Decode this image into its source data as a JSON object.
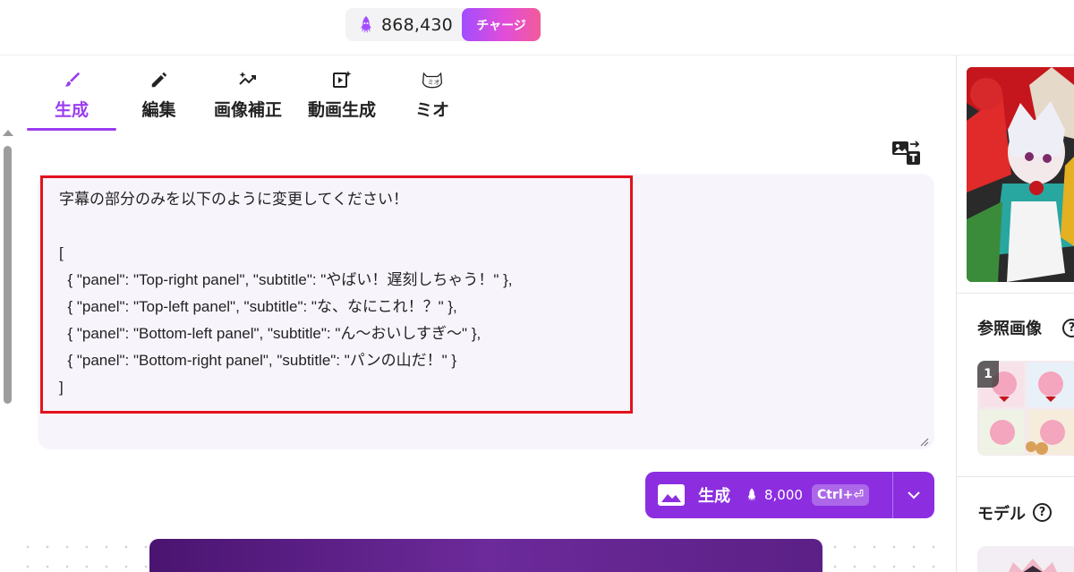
{
  "header": {
    "credits": "868,430",
    "charge_label": "チャージ",
    "credit_icon": "squid-icon"
  },
  "tabs": [
    {
      "label": "生成",
      "icon": "brush-icon",
      "active": true
    },
    {
      "label": "編集",
      "icon": "pencil-icon",
      "active": false
    },
    {
      "label": "画像補正",
      "icon": "trend-sparkle-icon",
      "active": false
    },
    {
      "label": "動画生成",
      "icon": "video-sparkle-icon",
      "active": false
    },
    {
      "label": "ミオ",
      "icon": "cat-face-icon",
      "active": false
    }
  ],
  "prompt": {
    "text": "字幕の部分のみを以下のように変更してください！\n\n[\n  { \"panel\": \"Top-right panel\", \"subtitle\": \"やばい！遅刻しちゃう！\" },\n  { \"panel\": \"Top-left panel\", \"subtitle\": \"な、なにこれ！？\" },\n  { \"panel\": \"Bottom-left panel\", \"subtitle\": \"ん〜おいしすぎ〜\" },\n  { \"panel\": \"Bottom-right panel\", \"subtitle\": \"パンの山だ！\" }\n]"
  },
  "generate_button": {
    "label": "生成",
    "cost": "8,000",
    "shortcut": "Ctrl+⏎"
  },
  "right_panel": {
    "reference_title": "参照画像",
    "reference_badge": "1",
    "model_title": "モデル",
    "help_glyph": "?"
  },
  "colors": {
    "accent": "#9b3df0",
    "button": "#8c2ee0",
    "highlight": "#e3121c",
    "prompt_bg": "#f8f4fc"
  }
}
